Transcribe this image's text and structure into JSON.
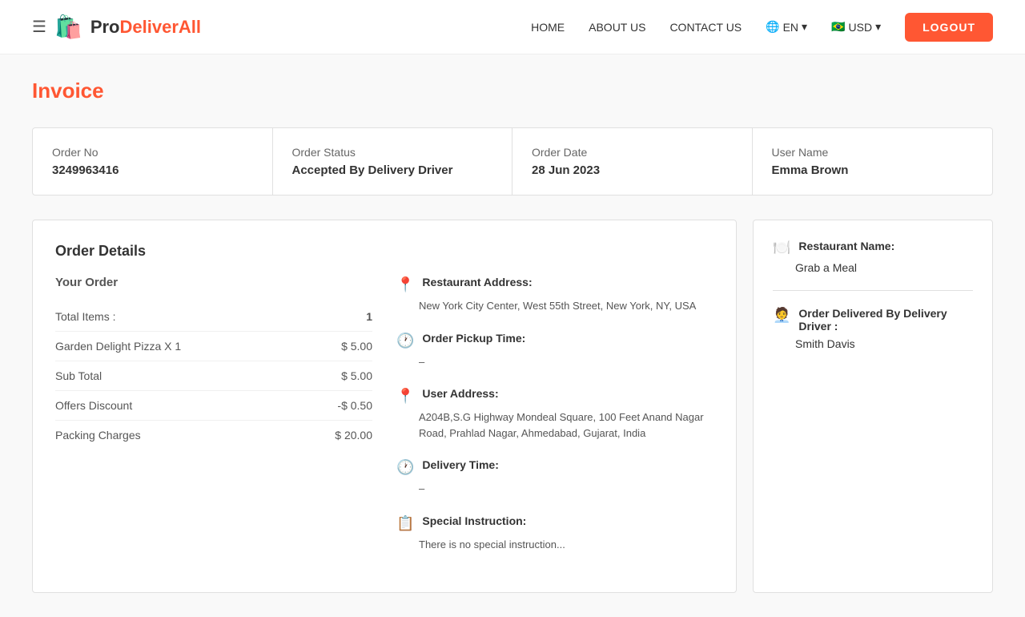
{
  "header": {
    "hamburger_icon": "☰",
    "logo_icon": "🛍️",
    "logo_pro": "Pro",
    "logo_deliver": "DeliverAll",
    "nav": [
      {
        "label": "HOME",
        "key": "home"
      },
      {
        "label": "ABOUT US",
        "key": "about"
      },
      {
        "label": "CONTACT US",
        "key": "contact"
      }
    ],
    "lang_flag": "🌐",
    "lang_label": "EN",
    "lang_chevron": "▾",
    "currency_flag": "🇧🇷",
    "currency_label": "USD",
    "currency_chevron": "▾",
    "logout_label": "LOGOUT"
  },
  "page": {
    "title": "Invoice"
  },
  "order_info": {
    "order_no_label": "Order No",
    "order_no_value": "3249963416",
    "status_label": "Order Status",
    "status_value": "Accepted By Delivery Driver",
    "date_label": "Order Date",
    "date_value": "28 Jun 2023",
    "user_label": "User Name",
    "user_value": "Emma Brown"
  },
  "order_details": {
    "section_title": "Order Details",
    "your_order_label": "Your Order",
    "total_items_label": "Total Items :",
    "total_items_value": "1",
    "line_items": [
      {
        "label": "Garden Delight Pizza X 1",
        "value": "$ 5.00"
      }
    ],
    "sub_total_label": "Sub Total",
    "sub_total_value": "$ 5.00",
    "discount_label": "Offers Discount",
    "discount_value": "-$ 0.50",
    "packing_label": "Packing Charges",
    "packing_value": "$ 20.00"
  },
  "delivery_info": {
    "restaurant_address_label": "Restaurant Address:",
    "restaurant_address_value": "New York City Center, West 55th Street, New York, NY, USA",
    "pickup_time_label": "Order Pickup Time:",
    "pickup_time_value": "–",
    "user_address_label": "User Address:",
    "user_address_value": "A204B,S.G Highway Mondeal Square, 100 Feet Anand Nagar Road, Prahlad Nagar, Ahmedabad, Gujarat, India",
    "delivery_time_label": "Delivery Time:",
    "delivery_time_value": "–",
    "special_instruction_label": "Special Instruction:",
    "special_instruction_value": "There is no special instruction..."
  },
  "right_panel": {
    "restaurant_name_label": "Restaurant Name:",
    "restaurant_name_value": "Grab a Meal",
    "driver_label": "Order Delivered By Delivery Driver :",
    "driver_value": "Smith Davis"
  },
  "icons": {
    "pin": "📍",
    "clock": "🕐",
    "list": "📋",
    "restaurant": "🍽️",
    "driver": "🧑‍💼"
  }
}
